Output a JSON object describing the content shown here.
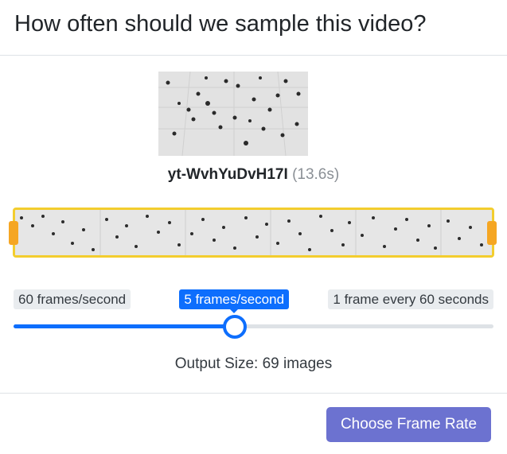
{
  "dialog": {
    "title": "How often should we sample this video?"
  },
  "video": {
    "id": "yt-WvhYuDvH17I",
    "duration": "(13.6s)"
  },
  "frame_rate": {
    "min_label": "60 frames/second",
    "selected_label": "5 frames/second",
    "max_label": "1 frame every 60 seconds",
    "slider_position_fraction": 0.46
  },
  "output": {
    "text": "Output Size: 69 images"
  },
  "footer": {
    "confirm_label": "Choose Frame Rate"
  },
  "colors": {
    "accent": "#0d6efd",
    "timeline_border": "#f3cd2e",
    "timeline_handle": "#f5a623",
    "confirm_button": "#6c72d0"
  },
  "icons": {
    "timeline_start_handle": "trim-handle-left-icon",
    "timeline_end_handle": "trim-handle-right-icon"
  }
}
